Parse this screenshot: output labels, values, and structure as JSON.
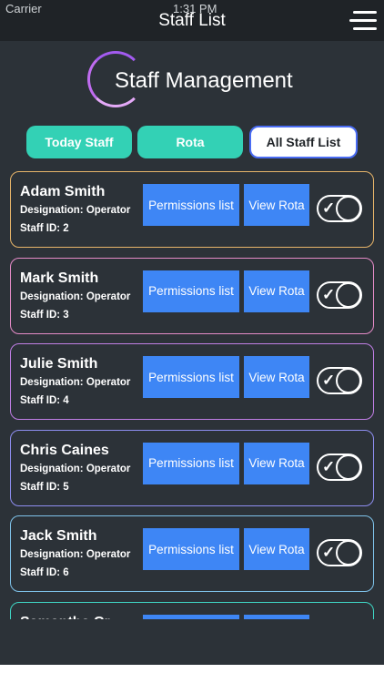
{
  "status": {
    "carrier": "Carrier",
    "time": "1:31 PM"
  },
  "nav": {
    "title": "Staff List",
    "menu_icon": "hamburger-menu-icon"
  },
  "brand": {
    "title": "Staff Management"
  },
  "tabs": [
    {
      "label": "Today Staff"
    },
    {
      "label": "Rota"
    },
    {
      "label": "All Staff List",
      "active": true
    }
  ],
  "staff": [
    {
      "name": "Adam Smith",
      "designation": "Designation: Operator",
      "staff_id": "Staff ID: 2",
      "permissions_label": "Permissions list",
      "rota_label": "View Rota",
      "enabled": true,
      "border_color": "#e7b56a"
    },
    {
      "name": "Mark Smith",
      "designation": "Designation: Operator",
      "staff_id": "Staff ID: 3",
      "permissions_label": "Permissions list",
      "rota_label": "View Rota",
      "enabled": true,
      "border_color": "#e58bc8"
    },
    {
      "name": "Julie Smith",
      "designation": "Designation: Operator",
      "staff_id": "Staff ID: 4",
      "permissions_label": "Permissions list",
      "rota_label": "View Rota",
      "enabled": true,
      "border_color": "#c17fe6"
    },
    {
      "name": "Chris Caines",
      "designation": "Designation: Operator",
      "staff_id": "Staff ID: 5",
      "permissions_label": "Permissions list",
      "rota_label": "View Rota",
      "enabled": true,
      "border_color": "#8e8ef0"
    },
    {
      "name": "Jack Smith",
      "designation": "Designation: Operator",
      "staff_id": "Staff ID: 6",
      "permissions_label": "Permissions list",
      "rota_label": "View Rota",
      "enabled": true,
      "border_color": "#7fc3ea"
    },
    {
      "name": "Samantha Cr",
      "designation": "",
      "staff_id": "",
      "permissions_label": "",
      "rota_label": "",
      "enabled": true,
      "border_color": "#3fd6c4"
    }
  ],
  "colors": {
    "accent_teal": "#33d1b5",
    "button_blue": "#3e86f5",
    "background": "#2c3238"
  }
}
